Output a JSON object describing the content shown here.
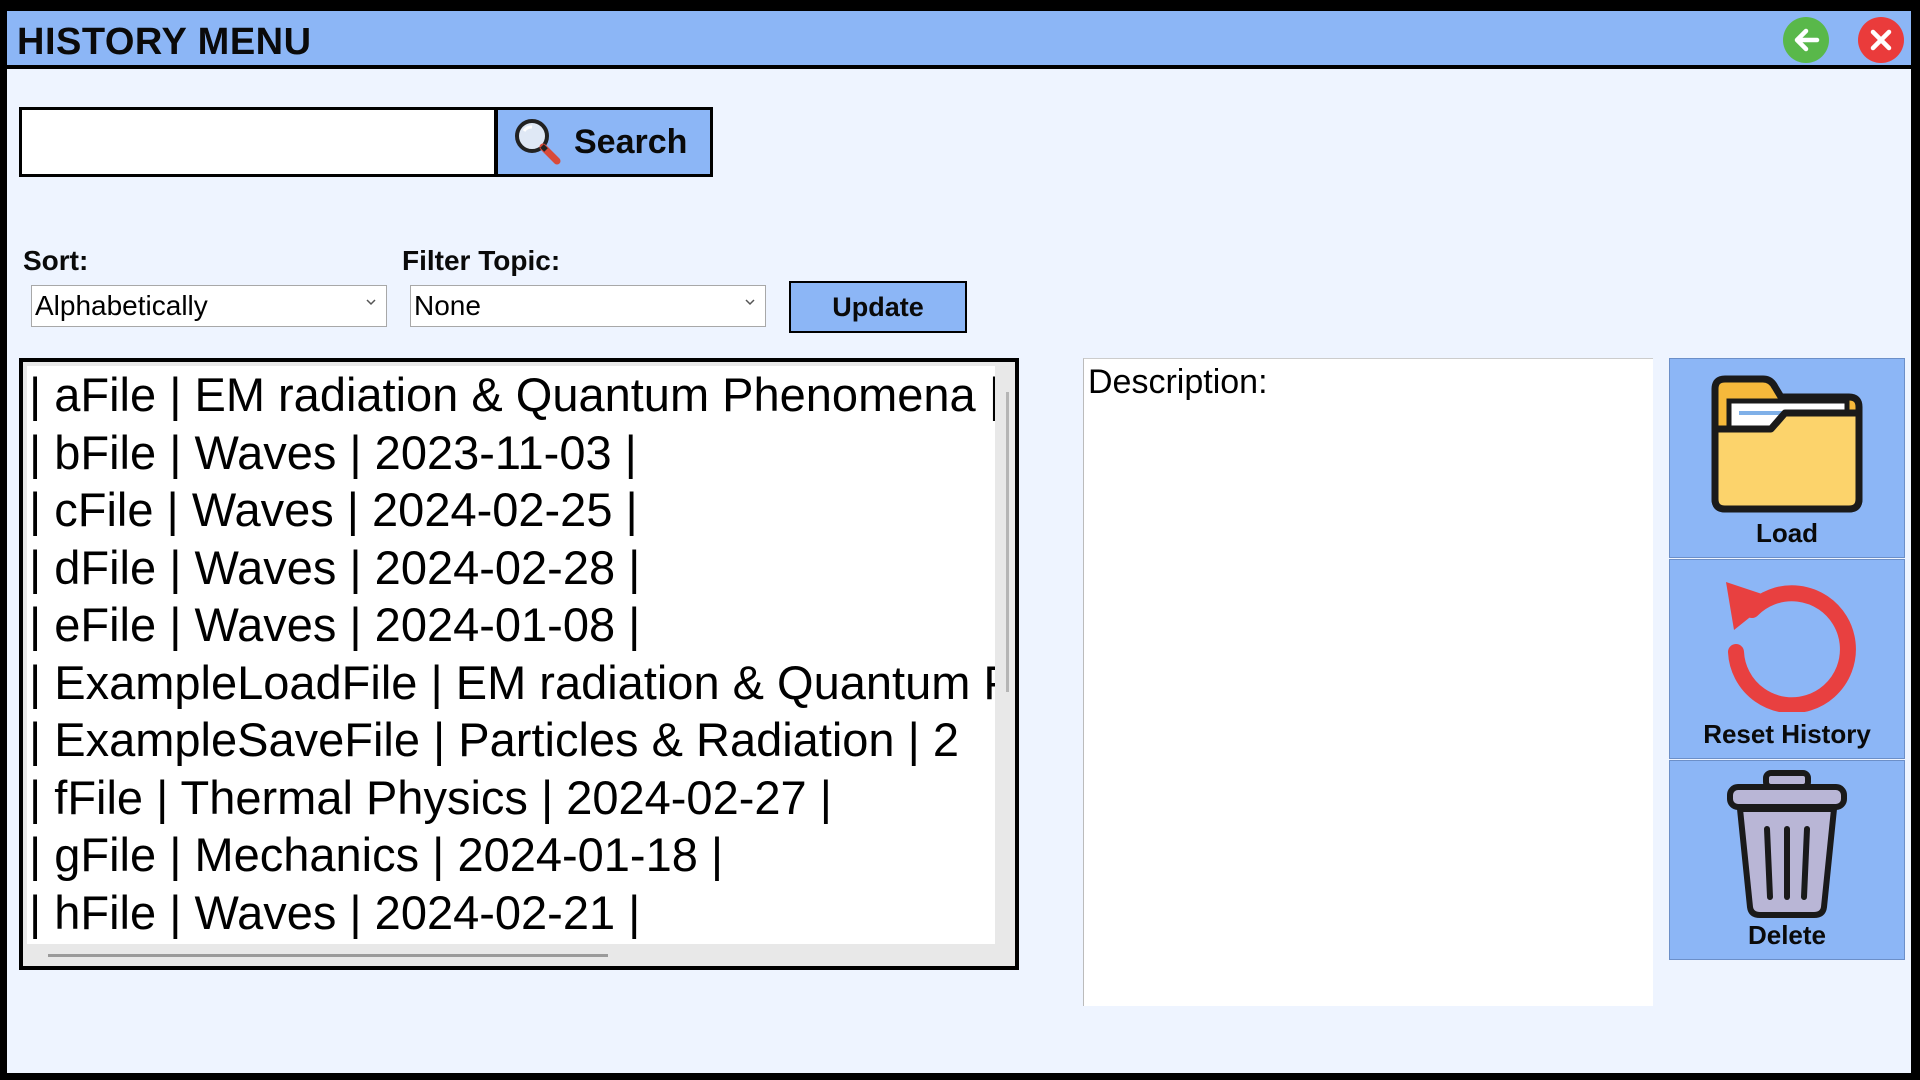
{
  "window": {
    "title": "HISTORY MENU",
    "controls": [
      {
        "name": "back",
        "icon": "arrow-left-icon",
        "color": "#59b84a"
      },
      {
        "name": "close",
        "icon": "close-icon",
        "color": "#ea3b3b"
      }
    ]
  },
  "search": {
    "value": "",
    "placeholder": "",
    "button_label": "Search",
    "icon": "search-icon"
  },
  "filters": {
    "sort_label": "Sort:",
    "sort_value": "Alphabetically",
    "topic_label": "Filter Topic:",
    "topic_value": "None",
    "update_label": "Update"
  },
  "history_list": {
    "items": [
      "| aFile | EM radiation & Quantum Phenomena | ",
      "| bFile | Waves | 2023-11-03 |",
      "| cFile | Waves | 2024-02-25 |",
      "| dFile | Waves | 2024-02-28 |",
      "| eFile | Waves | 2024-01-08 |",
      "| ExampleLoadFile | EM radiation & Quantum Phenomena |",
      "| ExampleSaveFile | Particles & Radiation | 2",
      "| fFile | Thermal Physics | 2024-02-27 |",
      "| gFile | Mechanics | 2024-01-18 |",
      "| hFile | Waves | 2024-02-21 |"
    ]
  },
  "description": {
    "label": "Description:",
    "text": ""
  },
  "actions": {
    "load_label": "Load",
    "reset_label": "Reset History",
    "delete_label": "Delete"
  },
  "colors": {
    "accent": "#8cb6f6",
    "background": "#eef4ff",
    "folder": "#fcd36b",
    "reset": "#e84040",
    "trash": "#b9b6d6"
  }
}
